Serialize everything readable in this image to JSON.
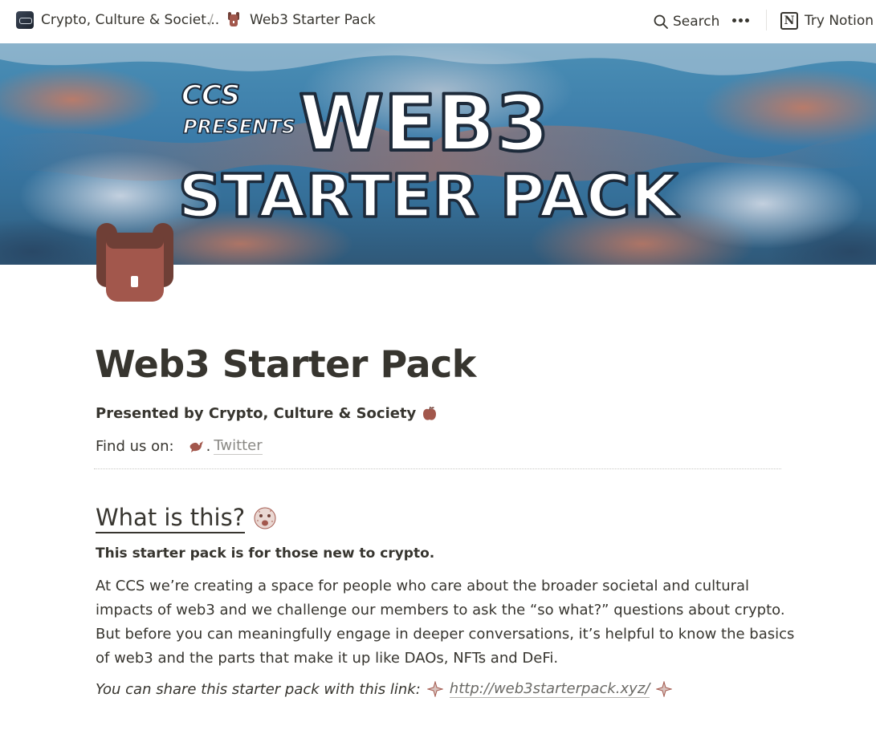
{
  "topbar": {
    "breadcrumb_parent": "Crypto, Culture & Societ...",
    "separator": "/",
    "breadcrumb_current": "Web3 Starter Pack",
    "search_label": "Search",
    "try_label": "Try Notion",
    "notion_logo_letter": "N"
  },
  "cover": {
    "line1": "CCS",
    "line2": "PRESENTS",
    "line3": "WEB3",
    "line4": "STARTER PACK",
    "colors": {
      "blue": "#3a7aa8",
      "rust": "#cd7a5f",
      "silver": "#dce1eb"
    }
  },
  "page": {
    "icon": "backpack-icon",
    "title": "Web3 Starter Pack",
    "presented_by": "Presented by Crypto, Culture & Society",
    "find_us_label": "Find us on:",
    "twitter_prefix": ".",
    "twitter_label": "Twitter",
    "section_heading": "What is this?",
    "bold_paragraph": "This starter pack is for those new to crypto.",
    "body_lines": [
      "At CCS we’re creating a space for people who care about the broader societal and cultural",
      "impacts of web3 and we challenge our members to ask the “so what?” questions about crypto.",
      "But before you can meaningfully engage in deeper conversations, it’s helpful to know the basics",
      "of web3 and the parts that make it up like DAOs, NFTs and DeFi."
    ],
    "share_text": "You can share this starter pack with this link:",
    "share_link": "http://web3starterpack.xyz/"
  }
}
